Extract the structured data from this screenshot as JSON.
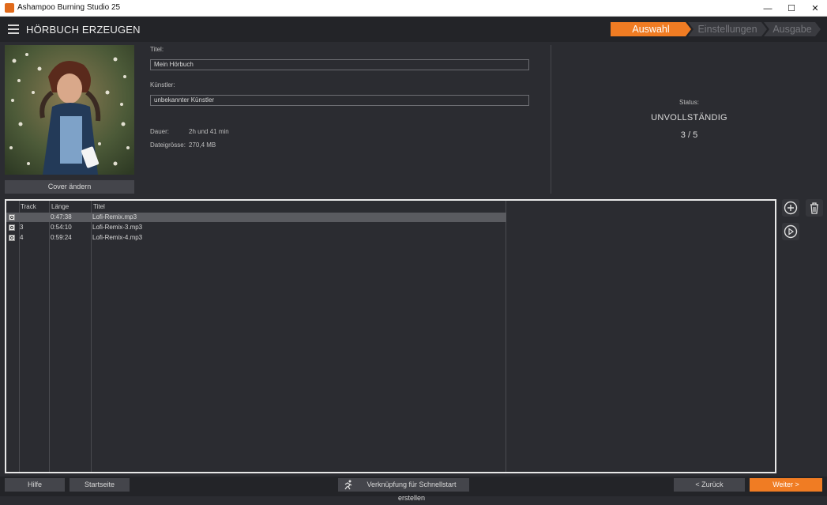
{
  "window": {
    "title": "Ashampoo Burning Studio 25"
  },
  "header": {
    "title": "HÖRBUCH ERZEUGEN"
  },
  "steps": [
    "Auswahl",
    "Einstellungen",
    "Ausgabe"
  ],
  "cover": {
    "button_label": "Cover ändern"
  },
  "form": {
    "title_label": "Titel:",
    "title_value": "Mein Hörbuch",
    "artist_label": "Künstler:",
    "artist_value": "unbekannter Künstler",
    "duration_label": "Dauer:",
    "duration_value": "2h und 41 min",
    "size_label": "Dateigrösse:",
    "size_value": "270,4 MB"
  },
  "status": {
    "label": "Status:",
    "value": "UNVOLLSTÄNDIG",
    "count": "3 / 5"
  },
  "tracklist": {
    "columns": [
      "Track",
      "Länge",
      "Titel"
    ],
    "rows": [
      {
        "track": "",
        "length": "0:47:38",
        "title": "Lofi-Remix.mp3",
        "selected": true
      },
      {
        "track": "3",
        "length": "0:54:10",
        "title": "Lofi-Remix-3.mp3",
        "selected": false
      },
      {
        "track": "4",
        "length": "0:59:24",
        "title": "Lofi-Remix-4.mp3",
        "selected": false
      }
    ]
  },
  "footer": {
    "help": "Hilfe",
    "home": "Startseite",
    "shortcut": "Verknüpfung für Schnellstart erstellen",
    "back": "< Zurück",
    "next": "Weiter >"
  },
  "colors": {
    "accent": "#f07c23",
    "background": "#2b2c31",
    "bar": "#232428"
  },
  "icons": [
    "app-flame-icon",
    "minimize-icon",
    "maximize-icon",
    "close-icon",
    "hamburger-icon",
    "add-circle-icon",
    "trash-icon",
    "play-circle-icon",
    "runner-icon",
    "track-checkbox-icon"
  ]
}
